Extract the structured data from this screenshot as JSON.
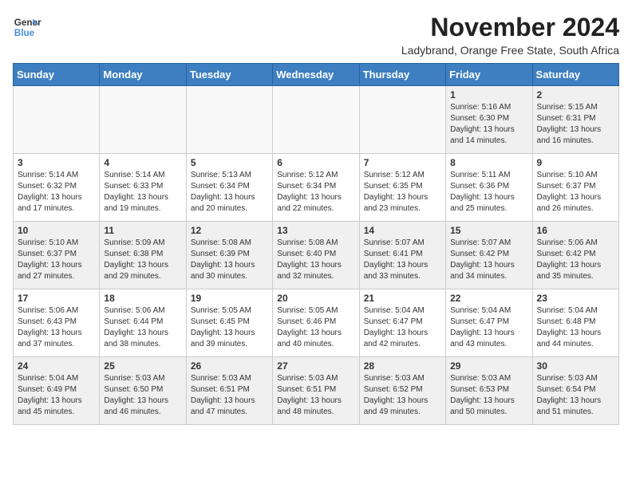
{
  "logo": {
    "line1": "General",
    "line2": "Blue"
  },
  "title": "November 2024",
  "subtitle": "Ladybrand, Orange Free State, South Africa",
  "days_of_week": [
    "Sunday",
    "Monday",
    "Tuesday",
    "Wednesday",
    "Thursday",
    "Friday",
    "Saturday"
  ],
  "weeks": [
    [
      {
        "day": "",
        "info": ""
      },
      {
        "day": "",
        "info": ""
      },
      {
        "day": "",
        "info": ""
      },
      {
        "day": "",
        "info": ""
      },
      {
        "day": "",
        "info": ""
      },
      {
        "day": "1",
        "info": "Sunrise: 5:16 AM\nSunset: 6:30 PM\nDaylight: 13 hours and 14 minutes."
      },
      {
        "day": "2",
        "info": "Sunrise: 5:15 AM\nSunset: 6:31 PM\nDaylight: 13 hours and 16 minutes."
      }
    ],
    [
      {
        "day": "3",
        "info": "Sunrise: 5:14 AM\nSunset: 6:32 PM\nDaylight: 13 hours and 17 minutes."
      },
      {
        "day": "4",
        "info": "Sunrise: 5:14 AM\nSunset: 6:33 PM\nDaylight: 13 hours and 19 minutes."
      },
      {
        "day": "5",
        "info": "Sunrise: 5:13 AM\nSunset: 6:34 PM\nDaylight: 13 hours and 20 minutes."
      },
      {
        "day": "6",
        "info": "Sunrise: 5:12 AM\nSunset: 6:34 PM\nDaylight: 13 hours and 22 minutes."
      },
      {
        "day": "7",
        "info": "Sunrise: 5:12 AM\nSunset: 6:35 PM\nDaylight: 13 hours and 23 minutes."
      },
      {
        "day": "8",
        "info": "Sunrise: 5:11 AM\nSunset: 6:36 PM\nDaylight: 13 hours and 25 minutes."
      },
      {
        "day": "9",
        "info": "Sunrise: 5:10 AM\nSunset: 6:37 PM\nDaylight: 13 hours and 26 minutes."
      }
    ],
    [
      {
        "day": "10",
        "info": "Sunrise: 5:10 AM\nSunset: 6:37 PM\nDaylight: 13 hours and 27 minutes."
      },
      {
        "day": "11",
        "info": "Sunrise: 5:09 AM\nSunset: 6:38 PM\nDaylight: 13 hours and 29 minutes."
      },
      {
        "day": "12",
        "info": "Sunrise: 5:08 AM\nSunset: 6:39 PM\nDaylight: 13 hours and 30 minutes."
      },
      {
        "day": "13",
        "info": "Sunrise: 5:08 AM\nSunset: 6:40 PM\nDaylight: 13 hours and 32 minutes."
      },
      {
        "day": "14",
        "info": "Sunrise: 5:07 AM\nSunset: 6:41 PM\nDaylight: 13 hours and 33 minutes."
      },
      {
        "day": "15",
        "info": "Sunrise: 5:07 AM\nSunset: 6:42 PM\nDaylight: 13 hours and 34 minutes."
      },
      {
        "day": "16",
        "info": "Sunrise: 5:06 AM\nSunset: 6:42 PM\nDaylight: 13 hours and 35 minutes."
      }
    ],
    [
      {
        "day": "17",
        "info": "Sunrise: 5:06 AM\nSunset: 6:43 PM\nDaylight: 13 hours and 37 minutes."
      },
      {
        "day": "18",
        "info": "Sunrise: 5:06 AM\nSunset: 6:44 PM\nDaylight: 13 hours and 38 minutes."
      },
      {
        "day": "19",
        "info": "Sunrise: 5:05 AM\nSunset: 6:45 PM\nDaylight: 13 hours and 39 minutes."
      },
      {
        "day": "20",
        "info": "Sunrise: 5:05 AM\nSunset: 6:46 PM\nDaylight: 13 hours and 40 minutes."
      },
      {
        "day": "21",
        "info": "Sunrise: 5:04 AM\nSunset: 6:47 PM\nDaylight: 13 hours and 42 minutes."
      },
      {
        "day": "22",
        "info": "Sunrise: 5:04 AM\nSunset: 6:47 PM\nDaylight: 13 hours and 43 minutes."
      },
      {
        "day": "23",
        "info": "Sunrise: 5:04 AM\nSunset: 6:48 PM\nDaylight: 13 hours and 44 minutes."
      }
    ],
    [
      {
        "day": "24",
        "info": "Sunrise: 5:04 AM\nSunset: 6:49 PM\nDaylight: 13 hours and 45 minutes."
      },
      {
        "day": "25",
        "info": "Sunrise: 5:03 AM\nSunset: 6:50 PM\nDaylight: 13 hours and 46 minutes."
      },
      {
        "day": "26",
        "info": "Sunrise: 5:03 AM\nSunset: 6:51 PM\nDaylight: 13 hours and 47 minutes."
      },
      {
        "day": "27",
        "info": "Sunrise: 5:03 AM\nSunset: 6:51 PM\nDaylight: 13 hours and 48 minutes."
      },
      {
        "day": "28",
        "info": "Sunrise: 5:03 AM\nSunset: 6:52 PM\nDaylight: 13 hours and 49 minutes."
      },
      {
        "day": "29",
        "info": "Sunrise: 5:03 AM\nSunset: 6:53 PM\nDaylight: 13 hours and 50 minutes."
      },
      {
        "day": "30",
        "info": "Sunrise: 5:03 AM\nSunset: 6:54 PM\nDaylight: 13 hours and 51 minutes."
      }
    ]
  ]
}
